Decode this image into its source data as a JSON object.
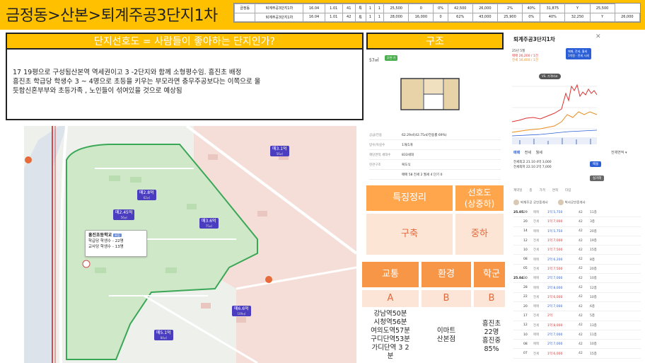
{
  "title": "금정동>산본>퇴계주공3단지1차",
  "data_strip": {
    "rows": [
      [
        "금정동",
        "퇴계주공3단지1차",
        "16.04",
        "1.01",
        "41",
        "특",
        "1",
        "1",
        "25,500",
        "0",
        "0%",
        "42,500",
        "26,000",
        "2%",
        "40%",
        "31,875",
        "Y",
        "25,500"
      ],
      [
        "",
        "퇴계주공3단지1차",
        "16.04",
        "1.01",
        "42",
        "특",
        "1",
        "1",
        "28,000",
        "16,000",
        "0",
        "62%",
        "43,000",
        "25,900",
        "0%",
        "40%",
        "32,250",
        "Y",
        "26,000"
      ]
    ]
  },
  "preference": {
    "header": "단지선호도 = 사람들이 좋아하는 단지인가?",
    "lines": [
      "17 19평으로 구성됨산본역 역세권이고 3 -2단지와 함께 소형평수임. 흥진초 배정",
      "흥진초  학급당  학생수   3 ~ 4명으로  초등을  키우는  부모라면  충무주공보다는  이쪽으로  울",
      "듯함신혼부부와 초등가족 ,  노인들이 섞여있을 것으로 예상됨"
    ]
  },
  "structure": {
    "header": "구조",
    "area_label": "57㎡",
    "area_badge": "추천·가",
    "specs": [
      {
        "k": "공급/전용",
        "v": "62.29㎡(42.75㎡/전용률 69%)"
      },
      {
        "k": "방수/욕실수",
        "v": "1개/1개"
      },
      {
        "k": "해당면적 세대수",
        "v": "833세대"
      },
      {
        "k": "현관구조",
        "v": "복도식"
      },
      {
        "k": "",
        "v": "매매 58   전세 2   월세 4   단기 0"
      }
    ]
  },
  "features": {
    "head_left": "특징정리",
    "head_right_1": "선호도",
    "head_right_2": "(상중하)",
    "body_left": "구축",
    "body_right": "중하"
  },
  "grades": {
    "columns": [
      {
        "head": "교통",
        "grade": "A",
        "detail": [
          "강남역50분",
          "시청역56분",
          "여의도역57분",
          "구디단역53분",
          "가디단역 3 2",
          "분"
        ]
      },
      {
        "head": "환경",
        "grade": "B",
        "detail": [
          "이마트",
          "산본점"
        ]
      },
      {
        "head": "학군",
        "grade": "B",
        "detail": [
          "흥진초",
          "22명",
          "흥진중",
          "85%"
        ]
      }
    ]
  },
  "map": {
    "pins": [
      {
        "label": "매3.1억",
        "sub": "56㎡"
      },
      {
        "label": "매2.8억",
        "sub": "62㎡"
      },
      {
        "label": "매2.45억",
        "sub": "56㎡"
      },
      {
        "label": "매3.6억",
        "sub": "75㎡"
      },
      {
        "label": "매6.6억",
        "sub": "109㎡"
      },
      {
        "label": "매5.1억",
        "sub": "84㎡"
      }
    ],
    "school": {
      "name": "흥진초등학교",
      "badge": "초등",
      "line1": "학급당 학생수 - 22명",
      "line2": "교사당 학생수 - 13명"
    }
  },
  "apartment": {
    "title": "퇴계주공3단지1차",
    "close": "✕",
    "chart_info": {
      "date": "25년 5월",
      "trade": "매매 26,200 / 1건",
      "lease": "전세 16,400 / 1건"
    },
    "chart_legend": [
      "매매, 전세, 월세",
      "1억원 · 전세 시세"
    ],
    "chart_pill": "VS. 가격비교",
    "tabs": [
      "매매",
      "전세",
      "월세"
    ],
    "sort": "전체면적 ▾",
    "summary": [
      "전세최고 21.10  4억 3,000",
      "전세최저 22.10  2억 7,000"
    ],
    "btn1": "매물",
    "btn2": "실거래",
    "table_header": [
      "계약일",
      "층",
      "가격",
      "면적",
      "타입"
    ],
    "agents": [
      "퇴계주공 공인중개사",
      "박사공인중개사"
    ],
    "rows": [
      {
        "d": "25.05",
        "t": "29",
        "type": "매매",
        "p": "1억 5,750",
        "a": "42",
        "f": "11층"
      },
      {
        "d": "",
        "t": "20",
        "type": "전세",
        "p": "1억 7,000",
        "a": "42",
        "f": "3층"
      },
      {
        "d": "",
        "t": "14",
        "type": "매매",
        "p": "1억 5,750",
        "a": "42",
        "f": "20층"
      },
      {
        "d": "",
        "t": "12",
        "type": "전세",
        "p": "1억 7,000",
        "a": "42",
        "f": "19층"
      },
      {
        "d": "",
        "t": "10",
        "type": "전세",
        "p": "1억 7,500",
        "a": "42",
        "f": "15층"
      },
      {
        "d": "",
        "t": "08",
        "type": "매매",
        "p": "2억 6,200",
        "a": "42",
        "f": "8층"
      },
      {
        "d": "",
        "t": "05",
        "type": "전세",
        "p": "1억 7,500",
        "a": "42",
        "f": "20층"
      },
      {
        "d": "25.04",
        "t": "30",
        "type": "매매",
        "p": "2억 7,000",
        "a": "42",
        "f": "10층"
      },
      {
        "d": "",
        "t": "28",
        "type": "매매",
        "p": "2억 8,000",
        "a": "42",
        "f": "12층"
      },
      {
        "d": "",
        "t": "22",
        "type": "전세",
        "p": "1억 6,000",
        "a": "42",
        "f": "10층"
      },
      {
        "d": "",
        "t": "20",
        "type": "매매",
        "p": "2억 7,000",
        "a": "42",
        "f": "6층"
      },
      {
        "d": "",
        "t": "17",
        "type": "전세",
        "p": "2억",
        "a": "42",
        "f": "5층"
      },
      {
        "d": "",
        "t": "12",
        "type": "전세",
        "p": "1억 8,000",
        "a": "42",
        "f": "13층"
      },
      {
        "d": "",
        "t": "10",
        "type": "매매",
        "p": "2억 7,000",
        "a": "42",
        "f": "11층"
      },
      {
        "d": "",
        "t": "08",
        "type": "매매",
        "p": "2억 7,000",
        "a": "42",
        "f": "10층"
      },
      {
        "d": "",
        "t": "07",
        "type": "전세",
        "p": "1억 6,000",
        "a": "42",
        "f": "15층"
      }
    ]
  },
  "colors": {
    "banner": "#ffc000",
    "feature_head": "#ffa64d",
    "grade_head": "#f79646",
    "accent_text": "#e06a3c",
    "pin": "#4b3dbf",
    "zone_green": "#cfe8c8"
  }
}
